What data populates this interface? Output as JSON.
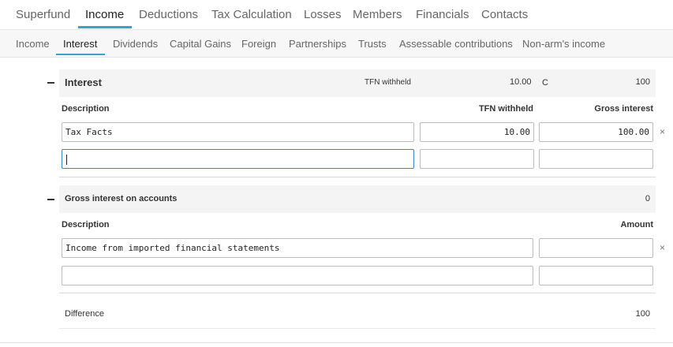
{
  "top_tabs": {
    "superfund": "Superfund",
    "income": "Income",
    "deductions": "Deductions",
    "tax_calculation": "Tax Calculation",
    "losses": "Losses",
    "members": "Members",
    "financials": "Financials",
    "contacts": "Contacts"
  },
  "sub_tabs": {
    "income": "Income",
    "interest": "Interest",
    "dividends": "Dividends",
    "capital_gains": "Capital Gains",
    "foreign": "Foreign",
    "partnerships": "Partnerships",
    "trusts": "Trusts",
    "assessable": "Assessable contributions",
    "non_arms": "Non-arm's income"
  },
  "interest_section": {
    "title": "Interest",
    "summary_label": "TFN withheld",
    "summary_tfn": "10.00",
    "summary_code": "C",
    "summary_total": "100",
    "col_description": "Description",
    "col_tfn": "TFN withheld",
    "col_gross": "Gross interest",
    "rows": [
      {
        "description": "Tax Facts",
        "tfn": "10.00",
        "gross": "100.00",
        "remove": "×"
      },
      {
        "description": "",
        "tfn": "",
        "gross": ""
      }
    ]
  },
  "gross_accounts_section": {
    "title": "Gross interest on accounts",
    "total": "0",
    "col_description": "Description",
    "col_amount": "Amount",
    "rows": [
      {
        "description": "Income from imported financial statements",
        "amount": "",
        "remove": "×"
      },
      {
        "description": "",
        "amount": ""
      }
    ]
  },
  "difference": {
    "label": "Difference",
    "value": "100"
  },
  "colors": {
    "accent": "#2aa7d9",
    "focus_border": "#3a86c8"
  }
}
